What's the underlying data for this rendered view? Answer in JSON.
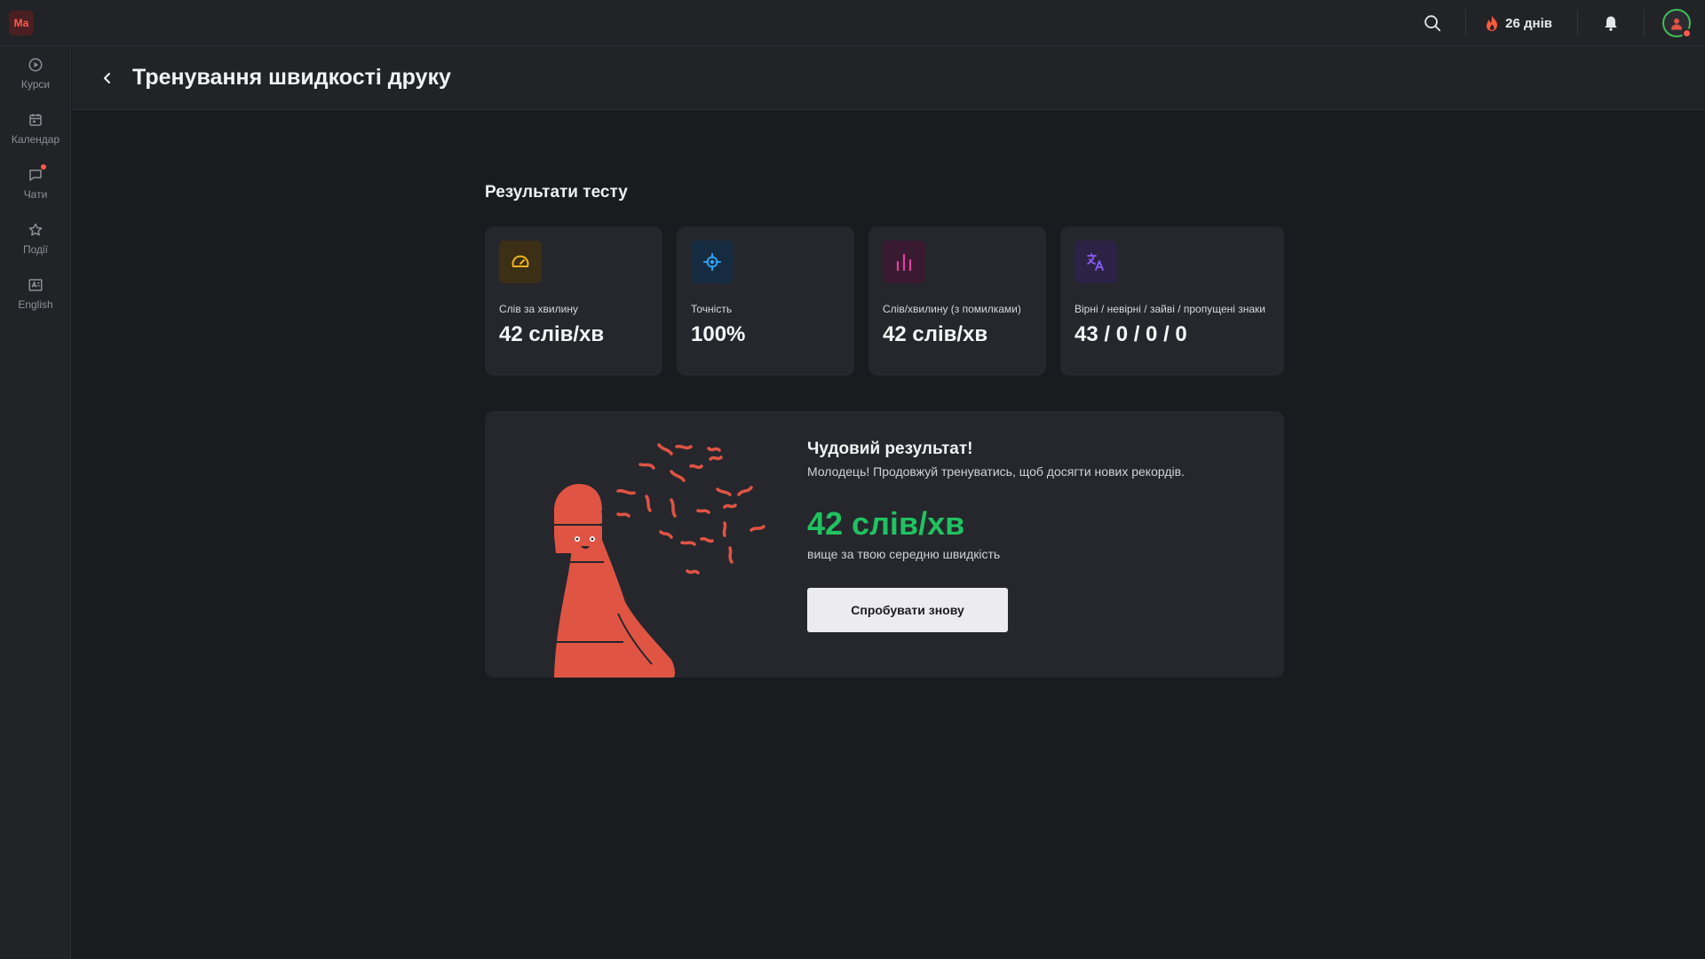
{
  "app": {
    "logo_text": "Ma"
  },
  "topbar": {
    "streak": "26 днів"
  },
  "sidebar": {
    "items": [
      {
        "label": "Курси",
        "icon": "play-circle-icon"
      },
      {
        "label": "Календар",
        "icon": "calendar-icon"
      },
      {
        "label": "Чати",
        "icon": "chat-icon"
      },
      {
        "label": "Події",
        "icon": "star-icon"
      },
      {
        "label": "English",
        "icon": "book-icon"
      }
    ]
  },
  "page": {
    "title": "Тренування швидкості друку"
  },
  "results": {
    "section_title": "Результати тесту",
    "cards": [
      {
        "label": "Слів за хвилину",
        "value": "42 слів/хв",
        "icon": "speedometer-icon",
        "accent": "#f2b220"
      },
      {
        "label": "Точність",
        "value": "100%",
        "icon": "crosshair-icon",
        "accent": "#2ea7ff"
      },
      {
        "label": "Слів/хвилину (з помилками)",
        "value": "42 слів/хв",
        "icon": "bar-chart-icon",
        "accent": "#e23ea1"
      },
      {
        "label": "Вірні / невірні / зайві / пропущені знаки",
        "value": "43 / 0 / 0 / 0",
        "icon": "translate-icon",
        "accent": "#8b5cf6"
      }
    ]
  },
  "summary": {
    "title": "Чудовий результат!",
    "subtitle": "Молодець! Продовжуй тренуватись, щоб досягти нових рекордів.",
    "speed": "42 слів/хв",
    "note": "вище за твою середню швидкість",
    "button": "Спробувати знову",
    "speed_color": "#20c261",
    "illustration_color": "#e05444"
  }
}
